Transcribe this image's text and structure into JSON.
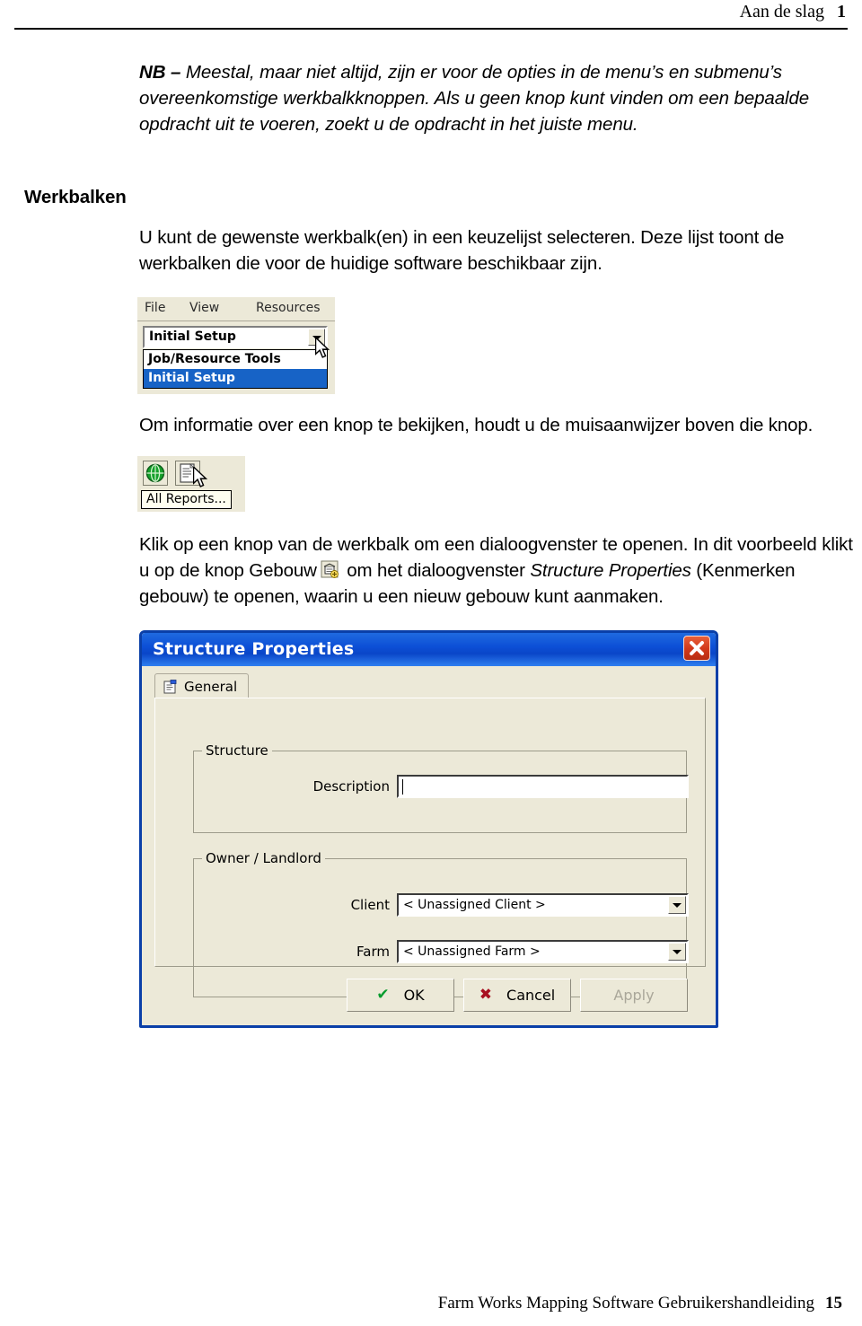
{
  "header": {
    "chapter_title": "Aan de slag",
    "page_number": "1"
  },
  "note": {
    "prefix": "NB –",
    "text": " Meestal, maar niet altijd, zijn er voor de opties in de menu’s en submenu’s overeenkomstige werkbalkknoppen. Als u geen knop kunt vinden om een bepaalde opdracht uit te voeren, zoekt u de opdracht in het juiste menu."
  },
  "section": {
    "heading": "Werkbalken",
    "paragraph_toolbars": "U kunt de gewenste werkbalk(en) in een keuzelijst selecteren. Deze lijst toont de werkbalken die voor de huidige software beschikbaar zijn.",
    "paragraph_tooltip": "Om informatie over een knop te bekijken, houdt u de muisaanwijzer boven die knop.",
    "paragraph_dialog_part1": "Klik op een knop van de werkbalk om een dialoogvenster te openen. In dit voorbeeld klikt u op de knop Gebouw",
    "paragraph_dialog_part2": " om het dialoogvenster ",
    "paragraph_dialog_italic": "Structure Properties",
    "paragraph_dialog_part3": " (Kenmerken gebouw) te openen, waarin u een nieuw gebouw kunt aanmaken."
  },
  "figure_toolbar_select": {
    "menu_items": [
      "File",
      "View",
      "Resources"
    ],
    "combo_value": "Initial Setup",
    "dropdown_options": [
      "Job/Resource Tools",
      "Initial Setup"
    ],
    "selected_option": "Initial Setup",
    "highlight_color": "#1763c6",
    "chrome_color": "#ece9d8"
  },
  "figure_tooltip": {
    "button_icons": [
      "globe-icon",
      "reports-document-icon"
    ],
    "tooltip_text": "All Reports..."
  },
  "dialog": {
    "title": "Structure Properties",
    "close_label": "✕",
    "titlebar_color": "#0c4fd6",
    "tab": {
      "label": "General",
      "icon": "properties-clipboard-icon"
    },
    "group_structure": {
      "title": "Structure",
      "description_label": "Description",
      "description_value": "",
      "description_placeholder": ""
    },
    "group_owner": {
      "title": "Owner / Landlord",
      "client_label": "Client",
      "client_value": "< Unassigned Client >",
      "farm_label": "Farm",
      "farm_value": "< Unassigned Farm >"
    },
    "buttons": {
      "ok": "OK",
      "ok_glyph": "✔",
      "cancel": "Cancel",
      "cancel_glyph": "✖",
      "apply": "Apply"
    }
  },
  "footer": {
    "document_title": "Farm Works Mapping Software Gebruikershandleiding",
    "page_number": "15"
  }
}
